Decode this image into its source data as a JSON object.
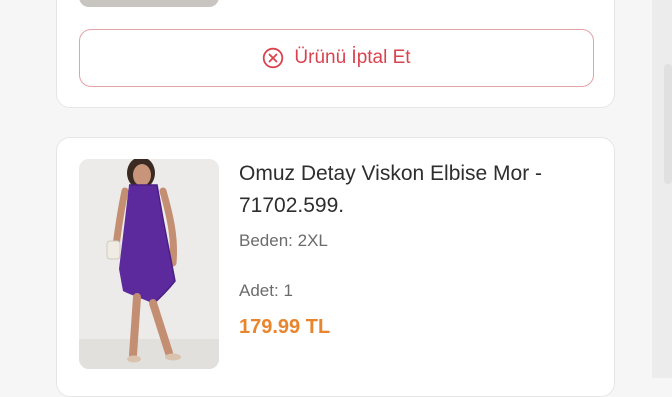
{
  "order_item_actions": {
    "cancel_label": "Ürünü İptal Et",
    "cancel_icon": "close-circle-icon",
    "accent_color": "#d9434f"
  },
  "product": {
    "title": "Omuz Detay Viskon Elbise Mor - 71702.599.",
    "size_label": "Beden:",
    "size_value": "2XL",
    "qty_label": "Adet:",
    "qty_value": "1",
    "price": "179.99 TL",
    "price_color": "#e8852d",
    "image_icon": "product-photo-purple-dress"
  }
}
